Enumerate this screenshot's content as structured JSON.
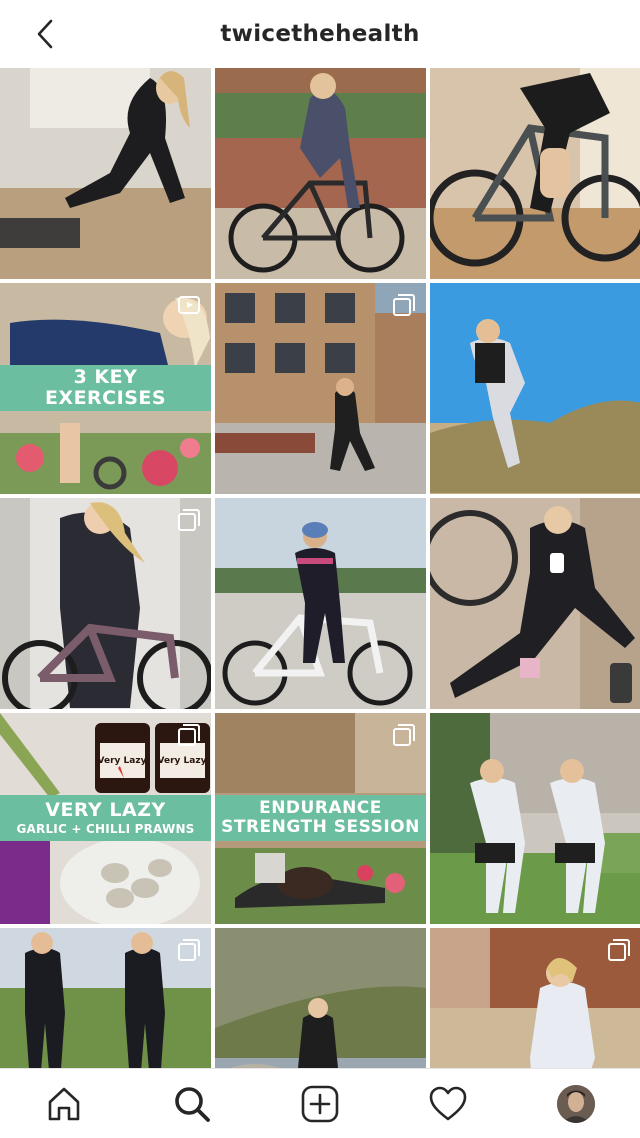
{
  "header": {
    "username": "twicethehealth",
    "back_icon": "chevron-left-icon"
  },
  "posts": [
    {
      "name": "post-home-lunge",
      "badge": ""
    },
    {
      "name": "post-bike-garden",
      "badge": ""
    },
    {
      "name": "post-bike-indoor",
      "badge": ""
    },
    {
      "name": "post-3-key-exercises",
      "badge": "video",
      "banner_lines": [
        "3 KEY",
        "EXERCISES"
      ]
    },
    {
      "name": "post-run-street",
      "badge": "multiple"
    },
    {
      "name": "post-run-beach",
      "badge": ""
    },
    {
      "name": "post-bike-conservatory",
      "badge": "multiple"
    },
    {
      "name": "post-bike-track",
      "badge": ""
    },
    {
      "name": "post-sitting-drink",
      "badge": ""
    },
    {
      "name": "post-garlic-chilli-prawns",
      "badge": "multiple",
      "banner_title": "VERY LAZY",
      "banner_subtitle": "GARLIC + CHILLI PRAWNS",
      "jar_label_1": "Very Lazy",
      "jar_label_2": "Very Lazy"
    },
    {
      "name": "post-endurance-strength",
      "badge": "multiple",
      "banner_title": "ENDURANCE",
      "banner_subtitle": "STRENGTH SESSION"
    },
    {
      "name": "post-two-runners",
      "badge": ""
    },
    {
      "name": "post-two-cyclists",
      "badge": "multiple"
    },
    {
      "name": "post-mountain-run",
      "badge": ""
    },
    {
      "name": "post-wall-sitting",
      "badge": "multiple"
    }
  ],
  "nav": {
    "items": [
      {
        "name": "home",
        "icon": "home-icon"
      },
      {
        "name": "search",
        "icon": "search-icon"
      },
      {
        "name": "new-post",
        "icon": "plus-square-icon"
      },
      {
        "name": "activity",
        "icon": "heart-icon"
      },
      {
        "name": "profile",
        "icon": "avatar"
      }
    ]
  },
  "colors": {
    "banner": "#6cbea0",
    "text": "#262626"
  }
}
